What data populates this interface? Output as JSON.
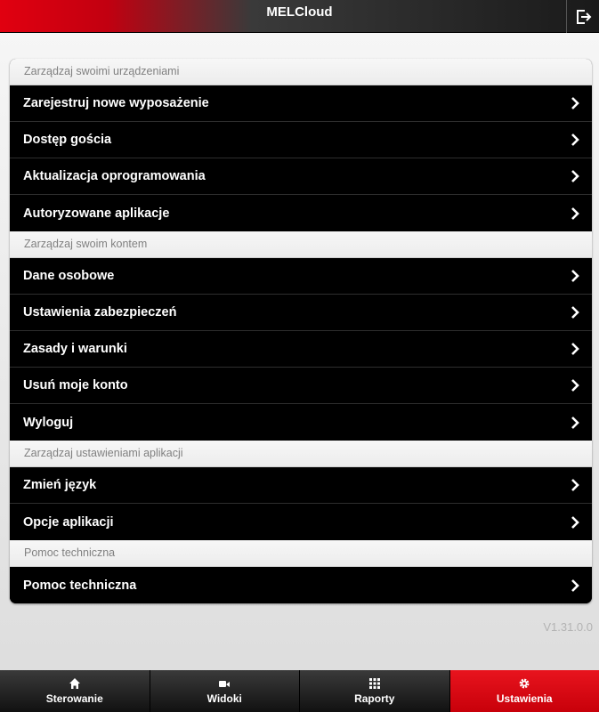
{
  "header": {
    "title": "MELCloud",
    "logout_icon": "logout-icon"
  },
  "sections": [
    {
      "title": "Zarządzaj swoimi urządzeniami",
      "items": [
        {
          "label": "Zarejestruj nowe wyposażenie"
        },
        {
          "label": "Dostęp gościa"
        },
        {
          "label": "Aktualizacja oprogramowania"
        },
        {
          "label": "Autoryzowane aplikacje"
        }
      ]
    },
    {
      "title": "Zarządzaj swoim kontem",
      "items": [
        {
          "label": "Dane osobowe"
        },
        {
          "label": "Ustawienia zabezpieczeń"
        },
        {
          "label": "Zasady i warunki"
        },
        {
          "label": "Usuń moje konto"
        },
        {
          "label": "Wyloguj"
        }
      ]
    },
    {
      "title": "Zarządzaj ustawieniami aplikacji",
      "items": [
        {
          "label": "Zmień język"
        },
        {
          "label": "Opcje aplikacji"
        }
      ]
    },
    {
      "title": "Pomoc techniczna",
      "items": [
        {
          "label": "Pomoc techniczna"
        }
      ]
    }
  ],
  "version": "V1.31.0.0",
  "tabs": [
    {
      "label": "Sterowanie",
      "icon": "home-icon",
      "active": false
    },
    {
      "label": "Widoki",
      "icon": "video-camera-icon",
      "active": false
    },
    {
      "label": "Raporty",
      "icon": "grid-icon",
      "active": false
    },
    {
      "label": "Ustawienia",
      "icon": "gear-icon",
      "active": true
    }
  ],
  "colors": {
    "accent": "#d40010",
    "row_bg": "#000000",
    "section_text": "#808080"
  }
}
